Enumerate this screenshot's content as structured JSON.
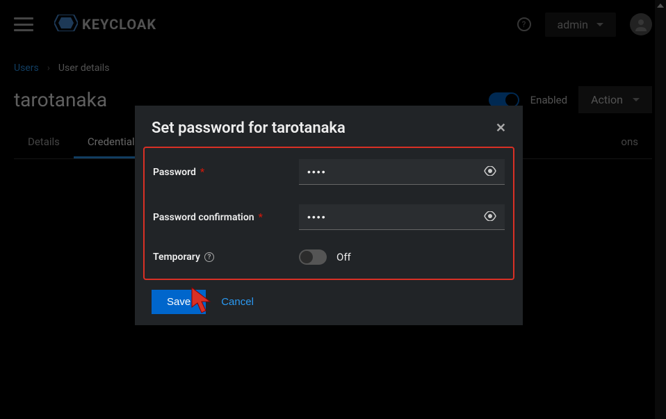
{
  "header": {
    "logo_text": "KEYCLOAK",
    "user_label": "admin"
  },
  "breadcrumb": {
    "parent": "Users",
    "current": "User details"
  },
  "page": {
    "title": "tarotanaka",
    "enabled_label": "Enabled",
    "action_label": "Action"
  },
  "tabs": {
    "details": "Details",
    "credentials": "Credentials",
    "partial": "ons"
  },
  "modal": {
    "title": "Set password for tarotanaka",
    "password_label": "Password",
    "password_value": "••••",
    "confirm_label": "Password confirmation",
    "confirm_value": "••••",
    "temporary_label": "Temporary",
    "temporary_state": "Off",
    "save_label": "Save",
    "cancel_label": "Cancel"
  }
}
